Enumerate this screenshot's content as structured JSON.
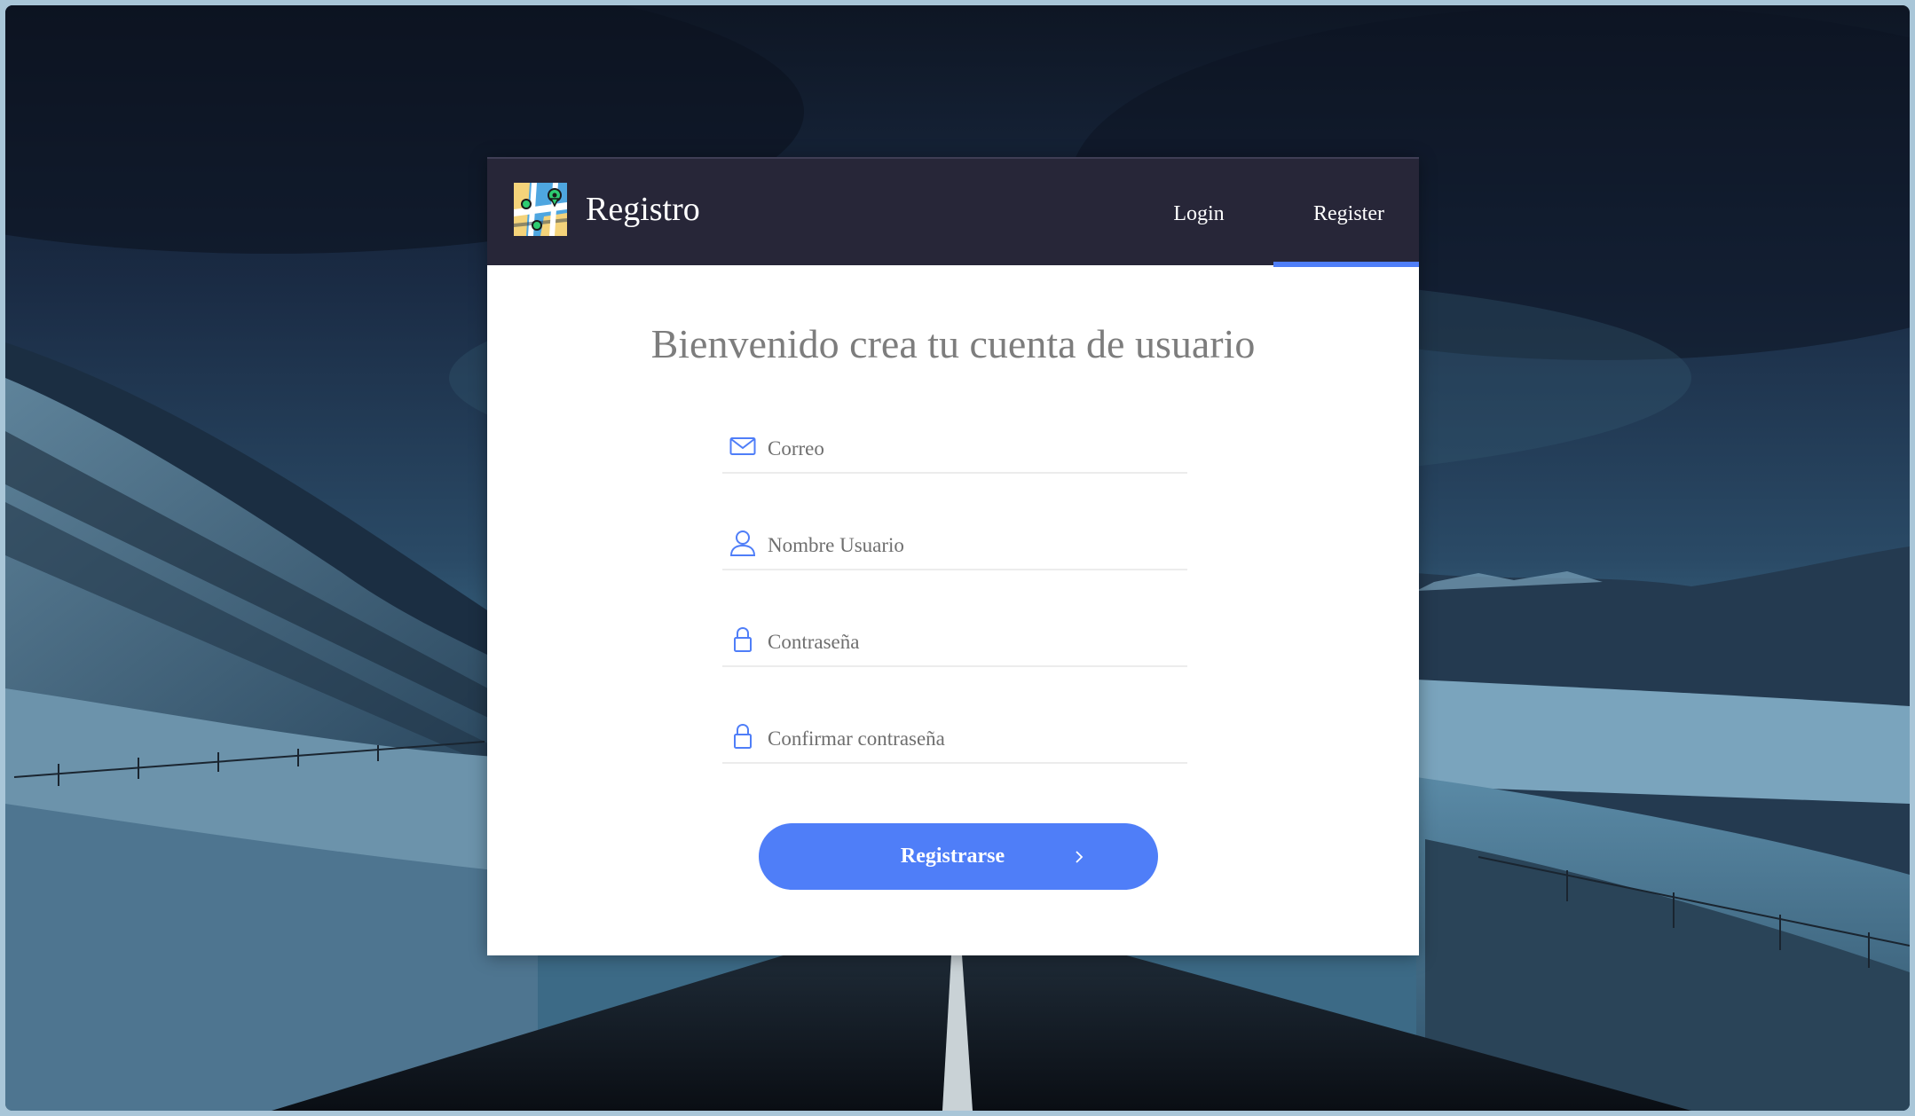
{
  "header": {
    "brand": "Registro",
    "nav": [
      {
        "label": "Login",
        "active": false
      },
      {
        "label": "Register",
        "active": true
      }
    ]
  },
  "main": {
    "title": "Bienvenido crea tu cuenta de usuario",
    "fields": [
      {
        "icon": "envelope-icon",
        "placeholder": "Correo",
        "value": ""
      },
      {
        "icon": "user-icon",
        "placeholder": "Nombre Usuario",
        "value": ""
      },
      {
        "icon": "lock-icon",
        "placeholder": "Contraseña",
        "value": ""
      },
      {
        "icon": "lock-icon",
        "placeholder": "Confirmar contraseña",
        "value": ""
      }
    ],
    "submit_label": "Registrarse",
    "submit_icon": "chevron-right-icon"
  },
  "colors": {
    "accent": "#4f7ef8",
    "header_bg": "#272638",
    "title_text": "#7d7d7d"
  }
}
